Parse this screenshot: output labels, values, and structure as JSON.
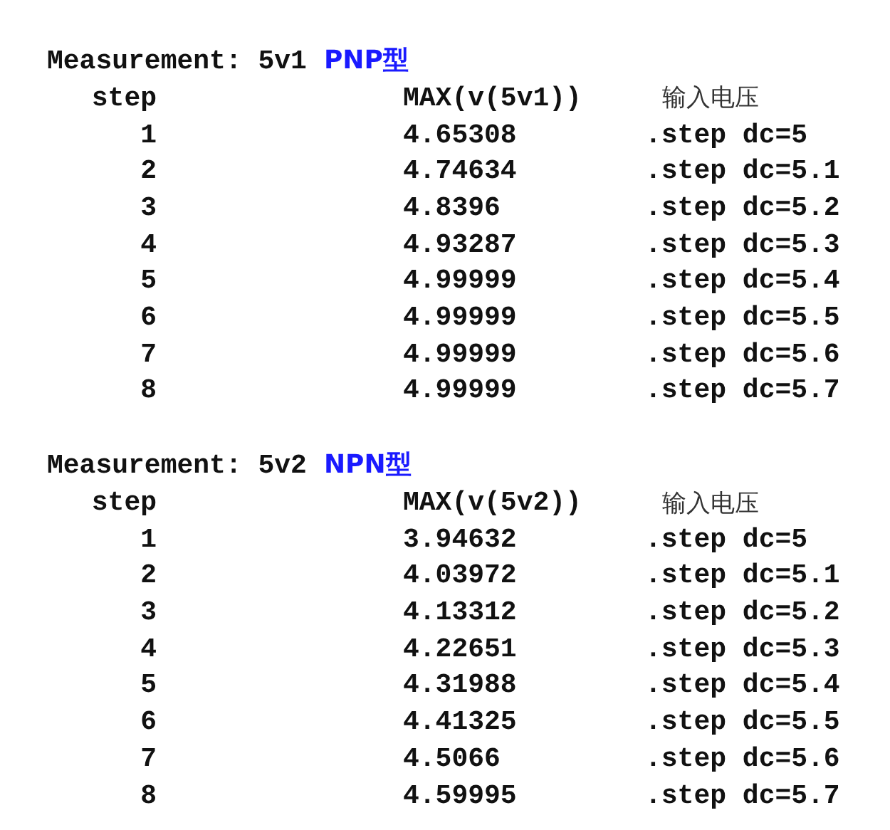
{
  "measurements": [
    {
      "label": "Measurement: 5v1",
      "type_tag": "PNP型",
      "columns": [
        "step",
        "MAX(v(5v1))",
        "输入电压"
      ],
      "rows": [
        [
          "1",
          "4.65308",
          ".step dc=5"
        ],
        [
          "2",
          "4.74634",
          ".step dc=5.1"
        ],
        [
          "3",
          "4.8396",
          ".step dc=5.2"
        ],
        [
          "4",
          "4.93287",
          ".step dc=5.3"
        ],
        [
          "5",
          "4.99999",
          ".step dc=5.4"
        ],
        [
          "6",
          "4.99999",
          ".step dc=5.5"
        ],
        [
          "7",
          "4.99999",
          ".step dc=5.6"
        ],
        [
          "8",
          "4.99999",
          ".step dc=5.7"
        ]
      ]
    },
    {
      "label": "Measurement: 5v2",
      "type_tag": "NPN型",
      "columns": [
        "step",
        "MAX(v(5v2))",
        "输入电压"
      ],
      "rows": [
        [
          "1",
          "3.94632",
          ".step dc=5"
        ],
        [
          "2",
          "4.03972",
          ".step dc=5.1"
        ],
        [
          "3",
          "4.13312",
          ".step dc=5.2"
        ],
        [
          "4",
          "4.22651",
          ".step dc=5.3"
        ],
        [
          "5",
          "4.31988",
          ".step dc=5.4"
        ],
        [
          "6",
          "4.41325",
          ".step dc=5.5"
        ],
        [
          "7",
          "4.5066",
          ".step dc=5.6"
        ],
        [
          "8",
          "4.59995",
          ".step dc=5.7"
        ]
      ]
    }
  ]
}
